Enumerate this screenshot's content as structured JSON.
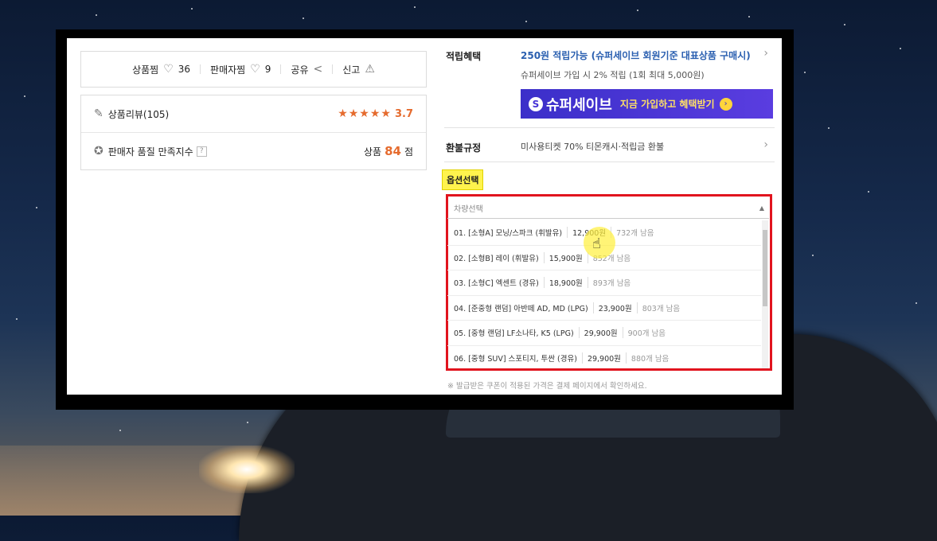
{
  "share_bar": {
    "product_like_label": "상품찜",
    "product_like_count": "36",
    "seller_like_label": "판매자찜",
    "seller_like_count": "9",
    "share_label": "공유",
    "report_label": "신고"
  },
  "review": {
    "label": "상품리뷰(105)",
    "stars": "★★★★★",
    "rating": "3.7"
  },
  "seller_quality": {
    "label": "판매자 품질 만족지수",
    "help": "?",
    "score_prefix": "상품",
    "score": "84",
    "score_suffix": "점"
  },
  "benefit": {
    "label": "적립혜택",
    "main": "250원 적립가능 (슈퍼세이브 회원기준 대표상품 구매시)",
    "sub": "슈퍼세이브 가입 시 2% 적립 (1회 최대 5,000원)",
    "banner_logo": "S",
    "banner_brand": "슈퍼세이브",
    "banner_cta": "지금 가입하고 혜택받기",
    "banner_go": "›"
  },
  "refund": {
    "label": "환불규정",
    "text": "미사용티켓 70% 티몬캐시·적립금 환불"
  },
  "options": {
    "label": "옵션선택",
    "select_placeholder": "차량선택",
    "items": [
      {
        "name": "01. [소형A] 모닝/스파크 (휘발유)",
        "price": "12,900원",
        "stock": "732개 남음"
      },
      {
        "name": "02. [소형B] 레이 (휘발유)",
        "price": "15,900원",
        "stock": "852개 남음"
      },
      {
        "name": "03. [소형C] 엑센트 (경유)",
        "price": "18,900원",
        "stock": "893개 남음"
      },
      {
        "name": "04. [준중형 랜덤] 아반떼 AD, MD (LPG)",
        "price": "23,900원",
        "stock": "803개 남음"
      },
      {
        "name": "05. [중형 랜덤] LF소나타, K5 (LPG)",
        "price": "29,900원",
        "stock": "900개 남음"
      },
      {
        "name": "06. [중형 SUV] 스포티지, 투싼 (경유)",
        "price": "29,900원",
        "stock": "880개 남음"
      }
    ],
    "note": "※ 발급받은 쿠폰이 적용된 가격은 결제 페이지에서 확인하세요."
  },
  "colors": {
    "accent_orange": "#e56b2e",
    "link_blue": "#2a5fb0",
    "highlight_red": "#e1141e",
    "label_yellow": "#fff34d"
  }
}
